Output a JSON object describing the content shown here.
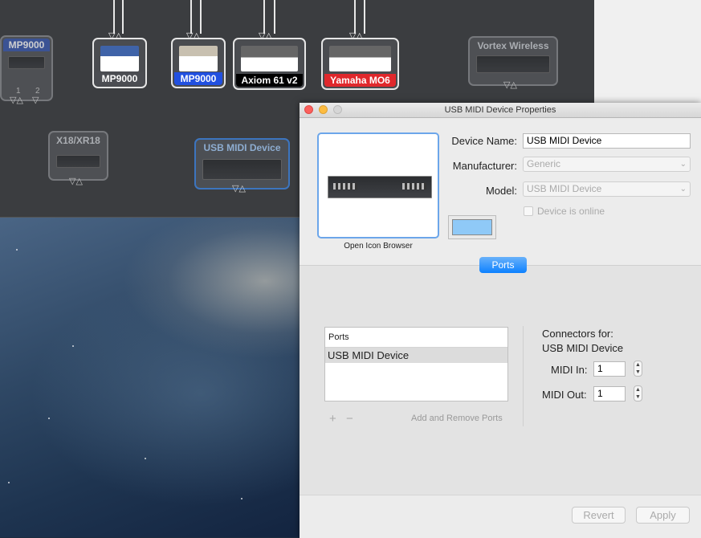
{
  "studio": {
    "devices": [
      {
        "label": "MP9000",
        "label_bg": "#3b5bb0",
        "label_pos": "top"
      },
      {
        "label": "MP9000",
        "label_bg": "#4b4d52"
      },
      {
        "label": "MP9000",
        "label_bg": "#2150e0"
      },
      {
        "label": "Axiom 61 v2",
        "label_bg": "#000000"
      },
      {
        "label": "Yamaha MO6",
        "label_bg": "#e0282c"
      },
      {
        "label": "Vortex Wireless",
        "label_bg": "#55575b",
        "label_pos": "top"
      },
      {
        "label": "X18/XR18",
        "label_bg": "#55575b",
        "label_pos": "top"
      },
      {
        "label": "USB MIDI Device",
        "label_bg": "#3f6fa8",
        "label_pos": "top"
      }
    ],
    "port_numbers": [
      "1",
      "2"
    ]
  },
  "window": {
    "title": "USB MIDI Device Properties",
    "icon_caption": "Open Icon Browser",
    "device_name_label": "Device Name:",
    "device_name_value": "USB MIDI Device",
    "manufacturer_label": "Manufacturer:",
    "manufacturer_value": "Generic",
    "model_label": "Model:",
    "model_value": "USB MIDI Device",
    "online_label": "Device is online",
    "swatch_color": "#8fc9f7",
    "tab_label": "Ports",
    "ports_header": "Ports",
    "ports_list": [
      "USB MIDI Device"
    ],
    "plus": "+",
    "minus": "−",
    "add_remove_label": "Add and Remove Ports",
    "connectors_title_1": "Connectors for:",
    "connectors_title_2": "USB MIDI Device",
    "midi_in_label": "MIDI In:",
    "midi_in_value": "1",
    "midi_out_label": "MIDI Out:",
    "midi_out_value": "1",
    "revert_label": "Revert",
    "apply_label": "Apply"
  }
}
